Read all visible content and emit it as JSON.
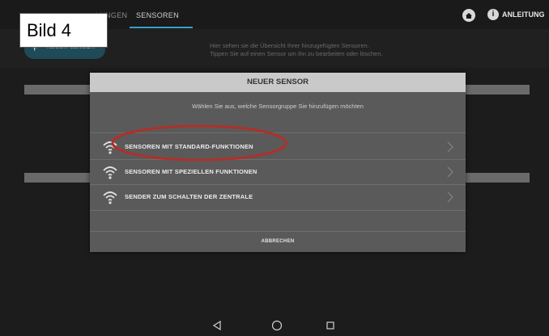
{
  "annotation_label": "Bild 4",
  "tabs": [
    {
      "label": "LUNGEN"
    },
    {
      "label": "SENSOREN"
    }
  ],
  "header_actions": {
    "guide_label": "ANLEITUNG",
    "home_icon": "home-icon",
    "info_icon": "info-icon"
  },
  "toolbar": {
    "new_sensor_label": "NEUER SENSOR",
    "hint_line1": "Hier sehen sie die Übersicht Ihrer hinzugefügten Sensoren.",
    "hint_line2": "Tippen Sie auf einen Sensor um ihn zu bearbeiten oder löschen."
  },
  "dialog": {
    "title": "NEUER SENSOR",
    "subtitle": "Wählen Sie aus, welche Sensorgruppe Sie hinzufügen möchten",
    "options": [
      {
        "label": "SENSOREN MIT STANDARD-FUNKTIONEN",
        "icon": "wireless-icon"
      },
      {
        "label": "SENSOREN MIT SPEZIELLEN FUNKTIONEN",
        "icon": "wireless-icon"
      },
      {
        "label": "SENDER ZUM SCHALTEN DER ZENTRALE",
        "icon": "wireless-icon"
      }
    ],
    "cancel_label": "ABBRECHEN"
  },
  "colors": {
    "accent": "#39a0c2",
    "highlight": "#b0302a",
    "dialog_bg": "#5a5a5a",
    "title_bg": "#c9c9c9"
  }
}
